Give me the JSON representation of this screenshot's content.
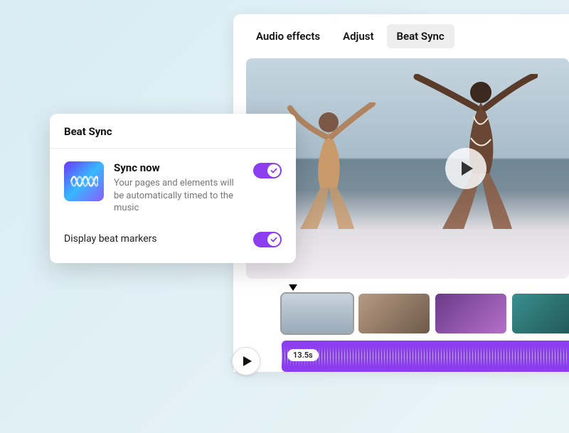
{
  "tabs": {
    "audio_effects": "Audio effects",
    "adjust": "Adjust",
    "beat_sync": "Beat Sync"
  },
  "popover": {
    "title": "Beat Sync",
    "sync_title": "Sync now",
    "sync_desc": "Your pages and elements will be automatically timed to the music",
    "display_markers_label": "Display beat markers",
    "sync_toggle_on": true,
    "display_markers_on": true
  },
  "timeline": {
    "audio_duration": "13.5s"
  },
  "colors": {
    "accent": "#8c3df0"
  }
}
